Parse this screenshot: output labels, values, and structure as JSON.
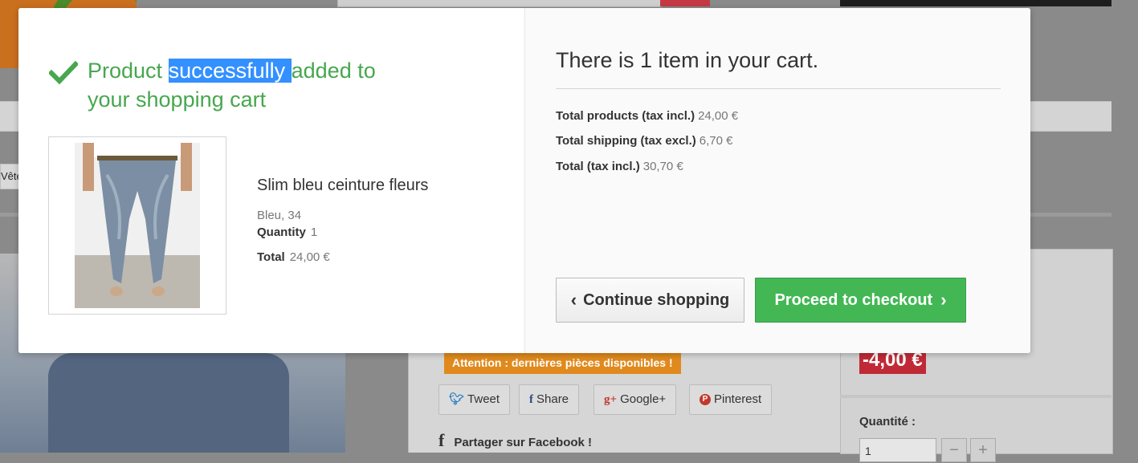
{
  "background": {
    "breadcrumb_text": "Vête",
    "attention_text": "Attention : dernières pièces disponibles !",
    "discount": "-4,00 €",
    "social": [
      {
        "icon": "twitter-icon",
        "glyph": "🐦",
        "label": "Tweet"
      },
      {
        "icon": "facebook-icon",
        "glyph": "f",
        "label": "Share"
      },
      {
        "icon": "google-plus-icon",
        "glyph": "g+",
        "label": "Google+"
      },
      {
        "icon": "pinterest-icon",
        "glyph": "P",
        "label": "Pinterest"
      }
    ],
    "facebook_share": "Partager sur Facebook !",
    "quantity_label": "Quantité :",
    "quantity_value": "1",
    "minus": "−",
    "plus": "+"
  },
  "modal": {
    "title_before": "Product ",
    "title_selected": "successfully ",
    "title_after": "added to your shopping cart",
    "product": {
      "name": "Slim bleu ceinture fleurs",
      "attributes": "Bleu, 34",
      "quantity_label": "Quantity",
      "quantity": "1",
      "total_label": "Total",
      "total": "24,00 €"
    },
    "cart_count_text": "There is 1 item in your cart.",
    "totals": [
      {
        "label": "Total products (tax incl.)",
        "value": "24,00 €"
      },
      {
        "label": "Total shipping (tax excl.)",
        "value": "6,70 €"
      },
      {
        "label": "Total (tax incl.)",
        "value": "30,70 €"
      }
    ],
    "continue_label": "Continue shopping",
    "checkout_label": "Proceed to checkout",
    "close_glyph": "✕"
  },
  "colors": {
    "success": "#46a74e",
    "checkout_button": "#43b754",
    "selection": "#3390ff",
    "discount_badge": "#c02a36",
    "attention_badge": "#e08a1d"
  }
}
